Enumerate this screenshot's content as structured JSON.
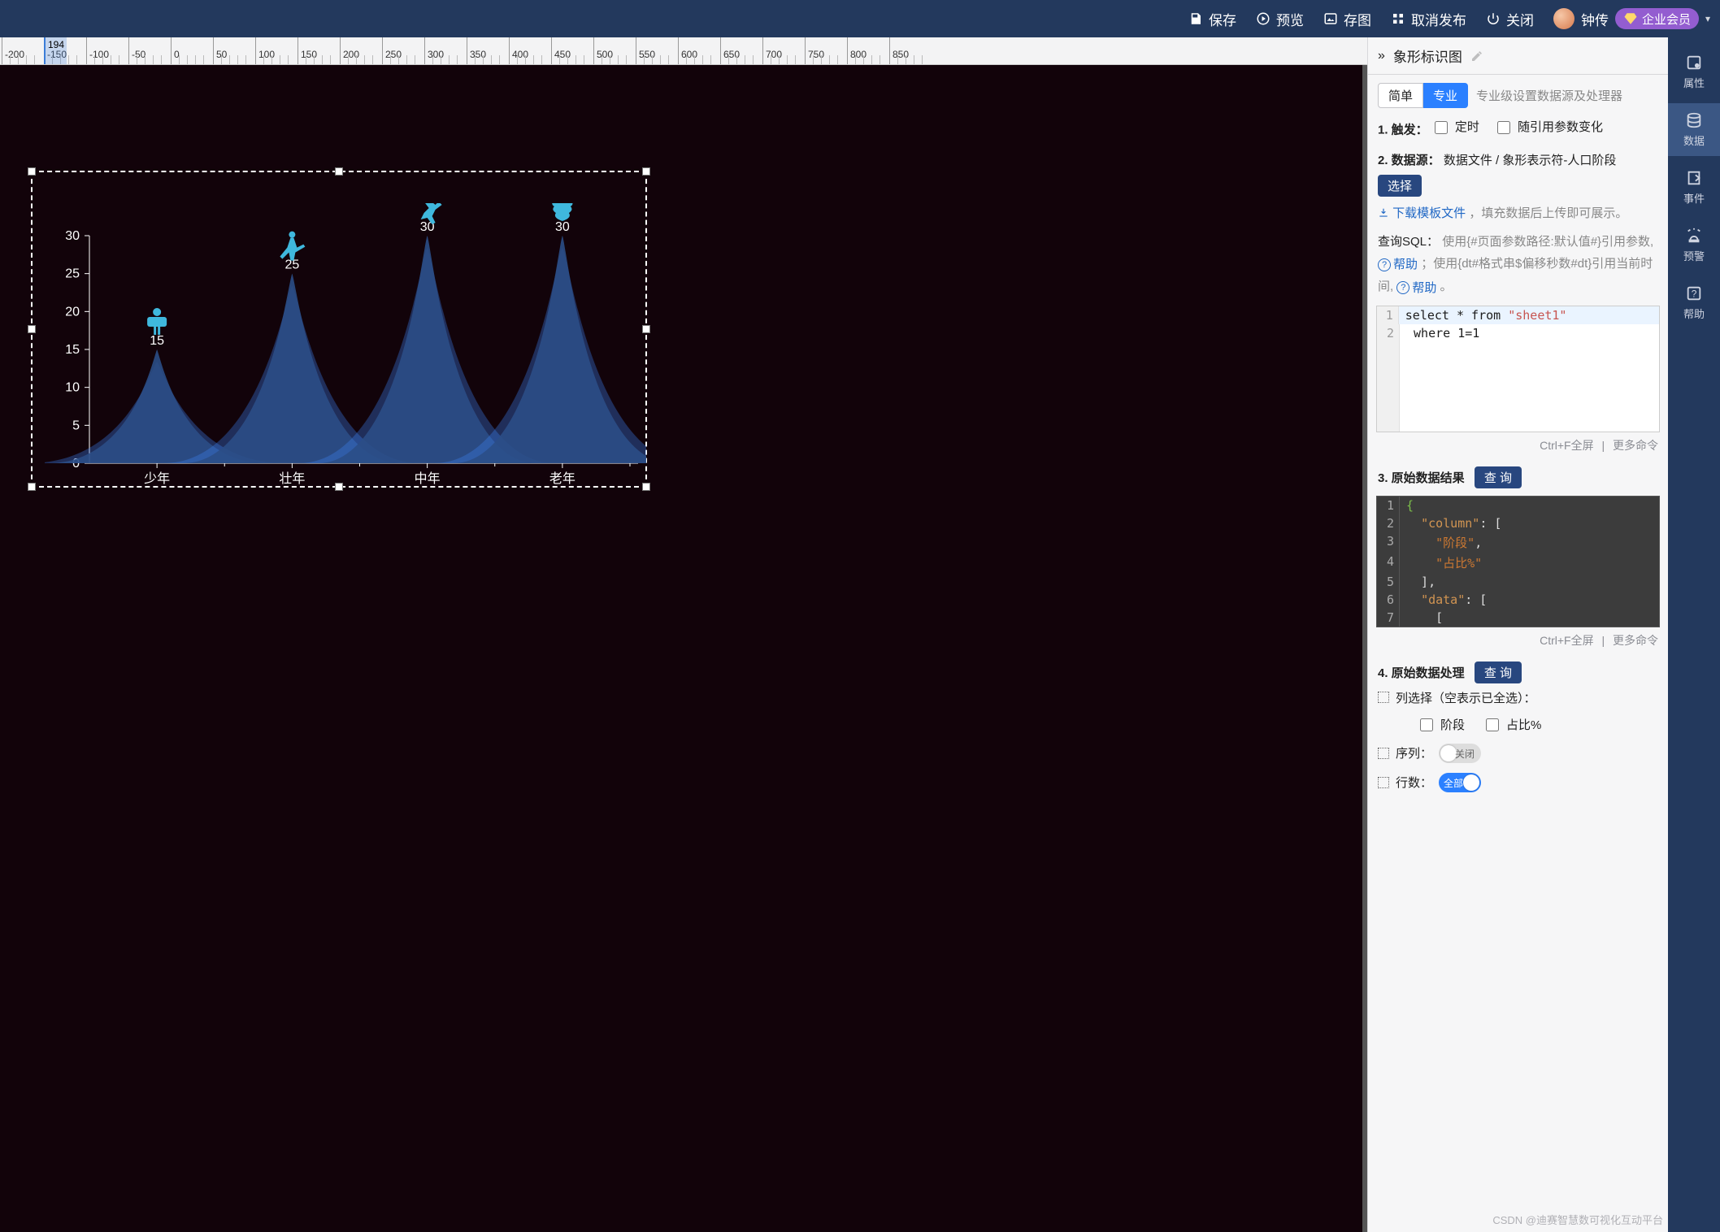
{
  "topbar": {
    "save": "保存",
    "preview": "预览",
    "save_image": "存图",
    "unpublish": "取消发布",
    "close": "关闭",
    "username": "钟传",
    "member_label": "企业会员"
  },
  "ruler": {
    "start": -200,
    "step": 50,
    "count": 22,
    "marker_value": "194",
    "marker_px": 54
  },
  "chart_data": {
    "type": "bar",
    "title": "",
    "xlabel": "",
    "ylabel": "",
    "ylim": [
      0,
      30
    ],
    "y_ticks": [
      0,
      5,
      10,
      15,
      20,
      25,
      30
    ],
    "categories": [
      "少年",
      "壮年",
      "中年",
      "老年"
    ],
    "values": [
      15,
      25,
      30,
      30
    ],
    "icon_names": [
      "child-icon",
      "martial-icon",
      "runner-icon",
      "elder-icon"
    ]
  },
  "panel": {
    "title": "象形标识图",
    "tabs": {
      "simple": "简单",
      "pro": "专业",
      "hint": "专业级设置数据源及处理器"
    },
    "sec1": {
      "label": "1. 触发：",
      "opt_timer": "定时",
      "opt_param": "随引用参数变化"
    },
    "sec2": {
      "label": "2. 数据源：",
      "path": "数据文件 / 象形表示符-人口阶段",
      "choose_btn": "选择",
      "download_tpl": "下载模板文件",
      "after_dl": "，填充数据后上传即可展示。",
      "sql_label": "查询SQL：",
      "sql_hint1": "使用{#页面参数路径:默认值#}引用参数, ",
      "help1": "帮助",
      "sql_hint2": " ；使用{dt#格式串$偏移秒数#dt}引用当前时间, ",
      "help2": "帮助",
      "period": " 。"
    },
    "sql_code": [
      {
        "n": 1,
        "text": "select * from ",
        "str": "\"sheet1\"",
        "hl": true
      },
      {
        "n": 2,
        "text": " where 1=1"
      }
    ],
    "code_actions": {
      "fullscreen": "Ctrl+F全屏",
      "more": "更多命令"
    },
    "sec3": {
      "label": "3. 原始数据结果",
      "query_btn": "查 询"
    },
    "result_code": [
      {
        "n": 1,
        "t": "{",
        "cls": "brace"
      },
      {
        "n": 2,
        "t": "  \"column\": ["
      },
      {
        "n": 3,
        "t": "    \"阶段\","
      },
      {
        "n": 4,
        "t": "    \"占比%\""
      },
      {
        "n": 5,
        "t": "  ],"
      },
      {
        "n": 6,
        "t": "  \"data\": ["
      },
      {
        "n": 7,
        "t": "    ["
      }
    ],
    "sec4": {
      "label": "4. 原始数据处理",
      "query_btn": "查 询"
    },
    "col_select": {
      "label": "列选择（空表示已全选）：",
      "opt1": "阶段",
      "opt2": "占比%"
    },
    "seq_row": {
      "label": "序列：",
      "state": "关闭"
    },
    "cnt_row": {
      "label": "行数：",
      "state": "全部"
    }
  },
  "rail": {
    "attr": "属性",
    "data": "数据",
    "event": "事件",
    "alarm": "预警",
    "help": "帮助"
  },
  "watermark": "CSDN @迪赛智慧数可视化互动平台"
}
